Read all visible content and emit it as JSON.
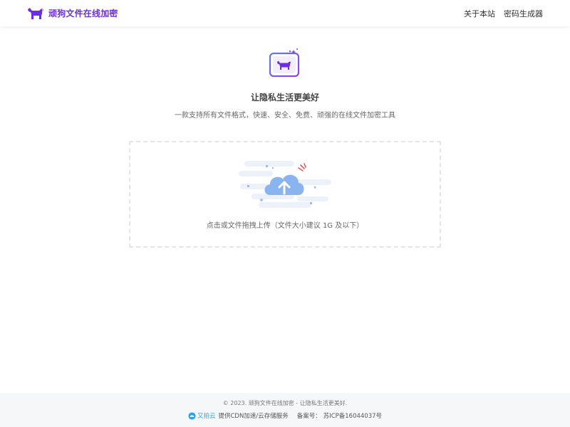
{
  "header": {
    "brand_title": "顽狗文件在线加密",
    "nav": [
      {
        "label": "关于本站"
      },
      {
        "label": "密码生成器"
      }
    ]
  },
  "hero": {
    "title": "让隐私生活更美好",
    "subtitle": "一款支持所有文件格式，快速、安全、免费、顽强的在线文件加密工具"
  },
  "dropzone": {
    "text": "点击或文件拖拽上传（文件大小建议 1G 及以下）"
  },
  "footer": {
    "copyright": "© 2023. 顽狗文件在线加密 - 让隐私生活更美好.",
    "upyun_name": "又拍云",
    "cdn_text": "提供CDN加速/云存储服务",
    "icp_label": "备案号：",
    "icp_number": "苏ICP备16044037号"
  },
  "colors": {
    "brand": "#6d2ee0",
    "upload_cloud": "#8ab4f0",
    "upyun": "#2aa4e6"
  },
  "icons": {
    "brand_logo": "dog-icon",
    "hero": "dog-frame-icon",
    "upload": "cloud-upload-icon"
  }
}
